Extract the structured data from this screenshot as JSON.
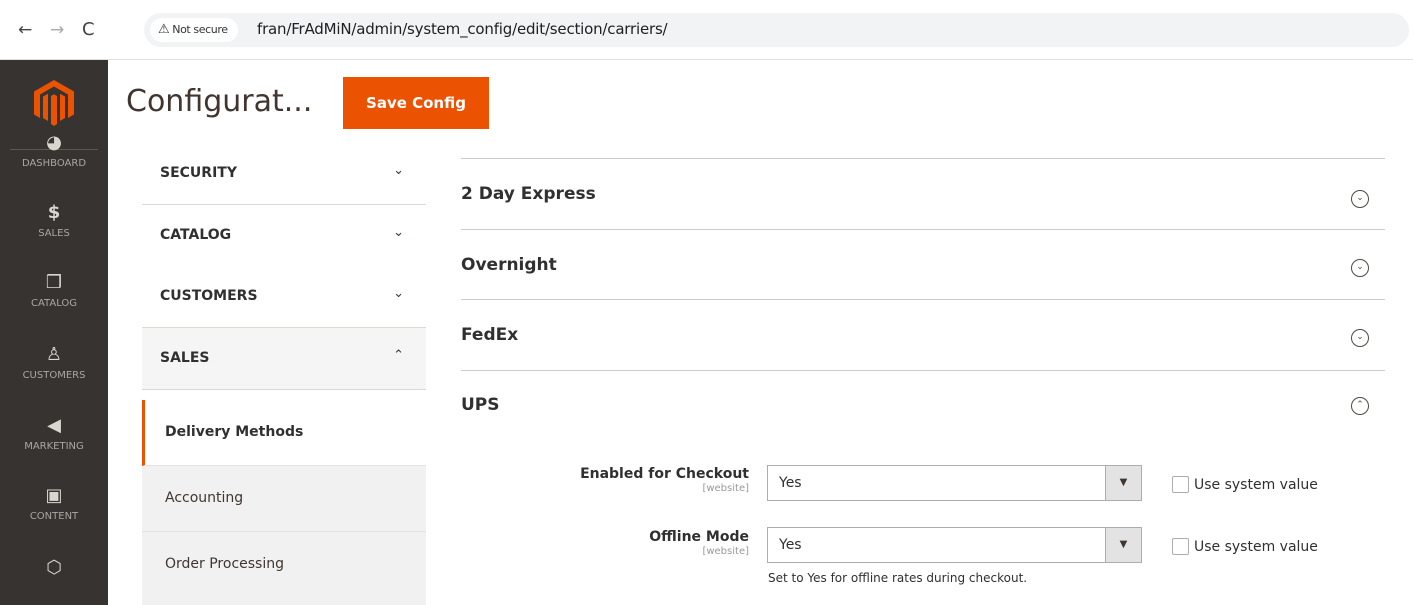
{
  "browser": {
    "back_glyph": "←",
    "forward_glyph": "→",
    "reload_glyph": "C",
    "security_warning_glyph": "⚠",
    "security_label": "Not secure",
    "url": "fran/FrAdMiN/admin/system_config/edit/section/carriers/"
  },
  "admin_nav": {
    "items": [
      {
        "label": "DASHBOARD",
        "icon": "dashboard-icon",
        "glyph": "◕"
      },
      {
        "label": "SALES",
        "icon": "dollar-icon",
        "glyph": "$"
      },
      {
        "label": "CATALOG",
        "icon": "box-icon",
        "glyph": "❒"
      },
      {
        "label": "CUSTOMERS",
        "icon": "person-icon",
        "glyph": "♙"
      },
      {
        "label": "MARKETING",
        "icon": "megaphone-icon",
        "glyph": "◀"
      },
      {
        "label": "CONTENT",
        "icon": "layout-icon",
        "glyph": "▣"
      },
      {
        "label": "",
        "icon": "hexagon-icon",
        "glyph": "⬡"
      }
    ]
  },
  "header": {
    "title": "Configurat...",
    "save_label": "Save Config"
  },
  "config_tabs": {
    "sections": [
      {
        "label": "SECURITY",
        "chevron": "⌄"
      },
      {
        "label": "CATALOG",
        "chevron": "⌄"
      },
      {
        "label": "CUSTOMERS",
        "chevron": "⌄"
      },
      {
        "label": "SALES",
        "chevron": "⌃"
      }
    ],
    "sales_items": [
      {
        "label": "Delivery Methods"
      },
      {
        "label": "Accounting"
      },
      {
        "label": "Order Processing"
      }
    ]
  },
  "main": {
    "groups": [
      {
        "title": "2 Day Express",
        "state": "collapsed",
        "glyph": "⌄"
      },
      {
        "title": "Overnight",
        "state": "collapsed",
        "glyph": "⌄"
      },
      {
        "title": "FedEx",
        "state": "collapsed",
        "glyph": "⌄"
      },
      {
        "title": "UPS",
        "state": "expanded",
        "glyph": "⌃"
      }
    ],
    "fields": [
      {
        "label": "Enabled for Checkout",
        "scope": "[website]",
        "value": "Yes",
        "use_system_label": "Use system value",
        "use_system_checked": false,
        "note": ""
      },
      {
        "label": "Offline Mode",
        "scope": "[website]",
        "value": "Yes",
        "use_system_label": "Use system value",
        "use_system_checked": false,
        "note": "Set to Yes for offline rates during checkout."
      }
    ],
    "select_arrow_glyph": "▼"
  },
  "colors": {
    "accent": "#eb5202",
    "nav_bg": "#373330",
    "title": "#41362f"
  }
}
